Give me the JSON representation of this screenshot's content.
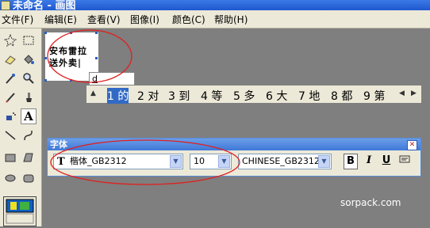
{
  "window": {
    "title": "未命名 - 画图"
  },
  "menu": [
    "文件(F)",
    "编辑(E)",
    "查看(V)",
    "图像(I)",
    "颜色(C)",
    "帮助(H)"
  ],
  "canvas": {
    "text": [
      "安布雷拉",
      "送外卖|"
    ]
  },
  "ime": {
    "composition": "d",
    "candidates": [
      "1 的",
      "2 对",
      "3 到",
      "4 等",
      "5 多",
      "6 大",
      "7 地",
      "8 都",
      "9 第"
    ],
    "selected_index": 0
  },
  "font_panel": {
    "title": "字体",
    "font": "楷体_GB2312",
    "size": "10",
    "script": "CHINESE_GB2312",
    "bold": "B",
    "italic": "I",
    "underline": "U"
  },
  "watermark": "sorpack.com",
  "colors": {
    "annotation": "#e02020",
    "titlebar": "#2a62d8",
    "ime_selection": "#316ac5"
  }
}
